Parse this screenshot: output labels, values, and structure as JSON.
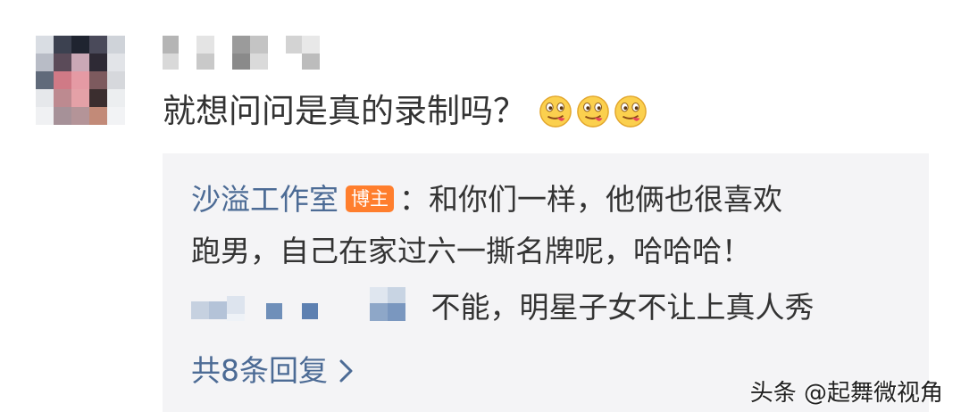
{
  "comment": {
    "text": "就想问问是真的录制吗？",
    "emojis": [
      "tongue-out-emoji",
      "tongue-out-emoji",
      "tongue-out-emoji"
    ]
  },
  "reply": {
    "author": "沙溢工作室",
    "badge": "博主",
    "line1": "：和你们一样，他俩也很喜欢",
    "line2": "跑男，自己在家过六一撕名牌呢，哈哈哈！",
    "sub_reply_text": "不能，明星子女不让上真人秀",
    "more_label": "共8条回复"
  },
  "watermark": "头条 @起舞微视角",
  "colors": {
    "link_blue": "#4c6b95",
    "badge_orange": "#ff7e2d",
    "reply_bg": "#f4f4f6"
  }
}
